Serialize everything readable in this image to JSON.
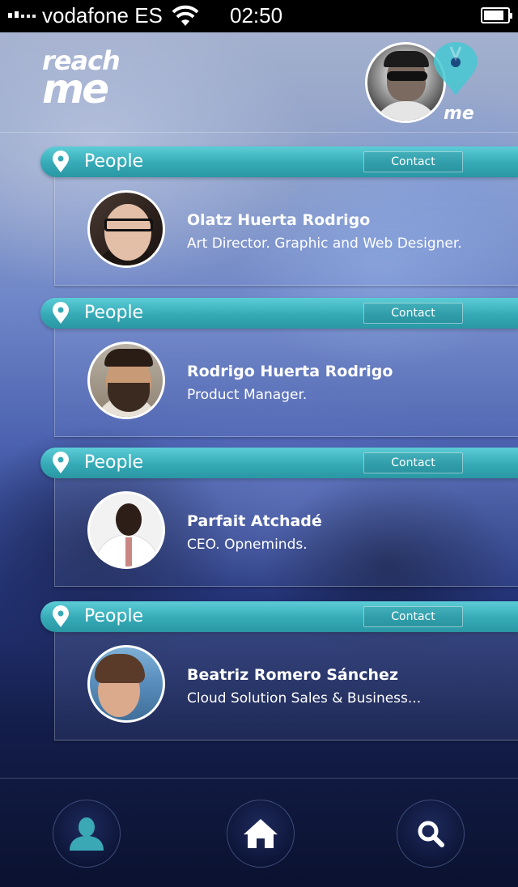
{
  "status_bar": {
    "carrier": "vodafone ES",
    "time": "02:50",
    "battery_level": 0.85
  },
  "header": {
    "logo_line1": "reach",
    "logo_line2": "me",
    "badge_label": "me"
  },
  "cards": [
    {
      "title": "People",
      "contact_label": "Contact",
      "name": "Olatz Huerta Rodrigo",
      "role": "Art Director. Graphic and Web Designer."
    },
    {
      "title": "People",
      "contact_label": "Contact",
      "name": "Rodrigo Huerta Rodrigo",
      "role": "Product Manager."
    },
    {
      "title": "People",
      "contact_label": "Contact",
      "name": "Parfait Atchadé",
      "role": "CEO. Opneminds."
    },
    {
      "title": "People",
      "contact_label": "Contact",
      "name": "Beatriz Romero Sánchez",
      "role": "Cloud  Solution Sales & Business..."
    }
  ],
  "bottom_nav": {
    "items": [
      {
        "icon": "person-icon"
      },
      {
        "icon": "home-icon"
      },
      {
        "icon": "search-icon"
      }
    ]
  },
  "colors": {
    "accent": "#35aab6",
    "nav_icon_person": "#3aa9b5"
  }
}
